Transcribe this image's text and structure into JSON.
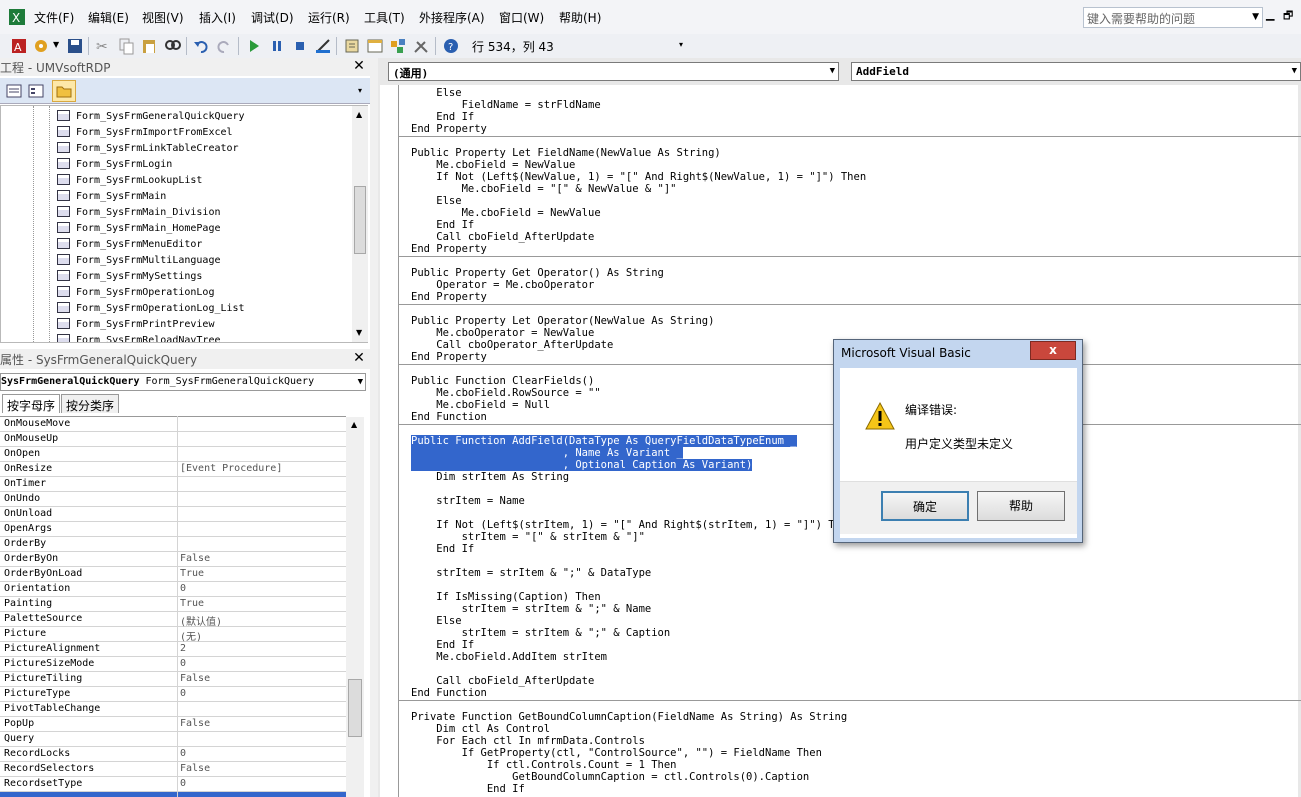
{
  "menu": {
    "items": [
      {
        "label": "文件(F)",
        "icon": "excel-icon"
      },
      {
        "label": "编辑(E)"
      },
      {
        "label": "视图(V)"
      },
      {
        "label": "插入(I)"
      },
      {
        "label": "调试(D)"
      },
      {
        "label": "运行(R)"
      },
      {
        "label": "工具(T)"
      },
      {
        "label": "外接程序(A)"
      },
      {
        "label": "窗口(W)"
      },
      {
        "label": "帮助(H)"
      }
    ],
    "help_placeholder": "键入需要帮助的问题"
  },
  "toolbar": {
    "cursor_position": "行 534，列 43"
  },
  "project": {
    "title": "工程 - UMVsoftRDP",
    "items": [
      "Form_SysFrmGeneralQuickQuery",
      "Form_SysFrmImportFromExcel",
      "Form_SysFrmLinkTableCreator",
      "Form_SysFrmLogin",
      "Form_SysFrmLookupList",
      "Form_SysFrmMain",
      "Form_SysFrmMain_Division",
      "Form_SysFrmMain_HomePage",
      "Form_SysFrmMenuEditor",
      "Form_SysFrmMultiLanguage",
      "Form_SysFrmMySettings",
      "Form_SysFrmOperationLog",
      "Form_SysFrmOperationLog_List",
      "Form_SysFrmPrintPreview",
      "Form_SysFrmReloadNavTree"
    ]
  },
  "properties": {
    "title": "属性 - SysFrmGeneralQuickQuery",
    "object_name": "SysFrmGeneralQuickQuery",
    "object_type": "Form_SysFrmGeneralQuickQuery",
    "tab_alpha": "按字母序",
    "tab_category": "按分类序",
    "rows": [
      {
        "name": "OnMouseMove",
        "value": ""
      },
      {
        "name": "OnMouseUp",
        "value": ""
      },
      {
        "name": "OnOpen",
        "value": ""
      },
      {
        "name": "OnResize",
        "value": "[Event Procedure]"
      },
      {
        "name": "OnTimer",
        "value": ""
      },
      {
        "name": "OnUndo",
        "value": ""
      },
      {
        "name": "OnUnload",
        "value": ""
      },
      {
        "name": "OpenArgs",
        "value": ""
      },
      {
        "name": "OrderBy",
        "value": ""
      },
      {
        "name": "OrderByOn",
        "value": "False"
      },
      {
        "name": "OrderByOnLoad",
        "value": "True"
      },
      {
        "name": "Orientation",
        "value": "0"
      },
      {
        "name": "Painting",
        "value": "True"
      },
      {
        "name": "PaletteSource",
        "value": "(默认值)"
      },
      {
        "name": "Picture",
        "value": "(无)"
      },
      {
        "name": "PictureAlignment",
        "value": "2"
      },
      {
        "name": "PictureSizeMode",
        "value": "0"
      },
      {
        "name": "PictureTiling",
        "value": "False"
      },
      {
        "name": "PictureType",
        "value": "0"
      },
      {
        "name": "PivotTableChange",
        "value": ""
      },
      {
        "name": "PopUp",
        "value": "False"
      },
      {
        "name": "Query",
        "value": ""
      },
      {
        "name": "RecordLocks",
        "value": "0"
      },
      {
        "name": "RecordSelectors",
        "value": "False"
      },
      {
        "name": "RecordsetType",
        "value": "0"
      }
    ]
  },
  "code": {
    "object_combo": "(通用)",
    "proc_combo": "AddField",
    "lines": [
      "    Else",
      "        FieldName = strFldName",
      "    End If",
      "End Property",
      "",
      "Public Property Let FieldName(NewValue As String)",
      "    Me.cboField = NewValue",
      "    If Not (Left$(NewValue, 1) = \"[\" And Right$(NewValue, 1) = \"]\") Then",
      "        Me.cboField = \"[\" & NewValue & \"]\"",
      "    Else",
      "        Me.cboField = NewValue",
      "    End If",
      "    Call cboField_AfterUpdate",
      "End Property",
      "",
      "Public Property Get Operator() As String",
      "    Operator = Me.cboOperator",
      "End Property",
      "",
      "Public Property Let Operator(NewValue As String)",
      "    Me.cboOperator = NewValue",
      "    Call cboOperator_AfterUpdate",
      "End Property",
      "",
      "Public Function ClearFields()",
      "    Me.cboField.RowSource = \"\"",
      "    Me.cboField = Null",
      "End Function",
      "",
      "Public Function AddField(DataType As QueryFieldDataTypeEnum _",
      "                        , Name As Variant _",
      "                        , Optional Caption As Variant)",
      "    Dim strItem As String",
      "",
      "    strItem = Name",
      "",
      "    If Not (Left$(strItem, 1) = \"[\" And Right$(strItem, 1) = \"]\") Then",
      "        strItem = \"[\" & strItem & \"]\"",
      "    End If",
      "",
      "    strItem = strItem & \";\" & DataType",
      "",
      "    If IsMissing(Caption) Then",
      "        strItem = strItem & \";\" & Name",
      "    Else",
      "        strItem = strItem & \";\" & Caption",
      "    End If",
      "    Me.cboField.AddItem strItem",
      "",
      "    Call cboField_AfterUpdate",
      "End Function",
      "",
      "Private Function GetBoundColumnCaption(FieldName As String) As String",
      "    Dim ctl As Control",
      "    For Each ctl In mfrmData.Controls",
      "        If GetProperty(ctl, \"ControlSource\", \"\") = FieldName Then",
      "            If ctl.Controls.Count = 1 Then",
      "                GetBoundColumnCaption = ctl.Controls(0).Caption",
      "            End If"
    ]
  },
  "dialog": {
    "title": "Microsoft Visual Basic",
    "close_label": "x",
    "line1": "编译错误:",
    "line2": "用户定义类型未定义",
    "ok_label": "确定",
    "help_label": "帮助"
  }
}
